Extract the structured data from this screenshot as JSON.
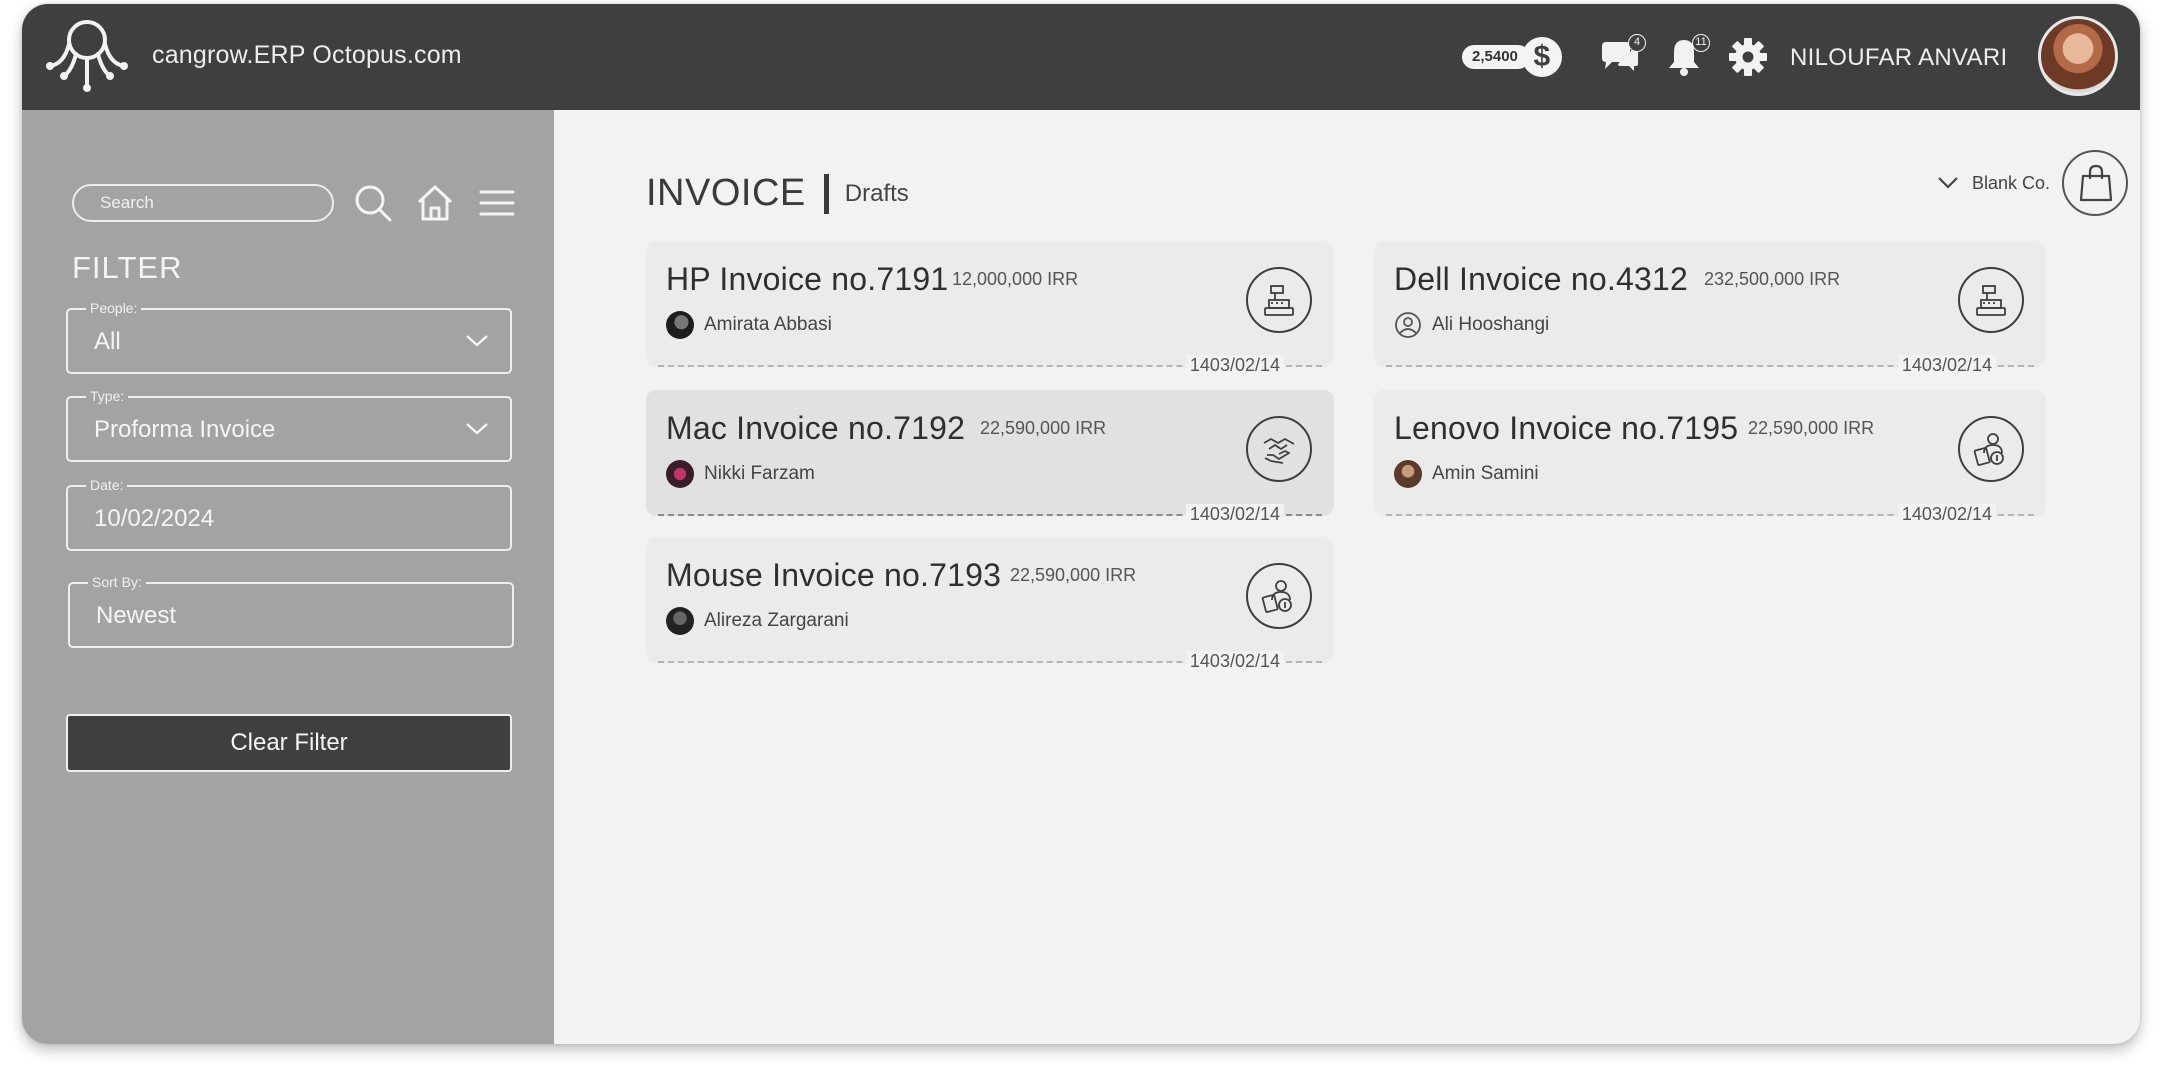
{
  "header": {
    "app_title": "cangrow.ERP Octopus.com",
    "balance": "2,5400",
    "currency_symbol": "$",
    "messages_count": "4",
    "notifications_count": "11",
    "user_name": "NILOUFAR ANVARI"
  },
  "sidebar": {
    "search_placeholder": "Search",
    "filter_title": "FILTER",
    "fields": [
      {
        "label": "People:",
        "value": "All"
      },
      {
        "label": "Type:",
        "value": "Proforma Invoice"
      },
      {
        "label": "Date:",
        "value": "10/02/2024"
      },
      {
        "label": "Sort By:",
        "value": "Newest"
      }
    ],
    "clear_button": "Clear Filter"
  },
  "main": {
    "title": "INVOICE",
    "subtitle": "Drafts",
    "company": "Blank Co.",
    "invoices": [
      {
        "title": "HP Invoice no.7191",
        "amount": "12,000,000 IRR",
        "person": "Amirata Abbasi",
        "date": "1403/02/14",
        "icon": "cash-register-icon"
      },
      {
        "title": "Mac Invoice no.7192",
        "amount": "22,590,000 IRR",
        "person": "Nikki Farzam",
        "date": "1403/02/14",
        "icon": "handshake-icon"
      },
      {
        "title": "Mouse Invoice no.7193",
        "amount": "22,590,000 IRR",
        "person": "Alireza Zargarani",
        "date": "1403/02/14",
        "icon": "client-money-icon"
      },
      {
        "title": "Dell Invoice no.4312",
        "amount": "232,500,000 IRR",
        "person": "Ali Hooshangi",
        "date": "1403/02/14",
        "icon": "cash-register-icon"
      },
      {
        "title": "Lenovo Invoice no.7195",
        "amount": "22,590,000 IRR",
        "person": "Amin Samini",
        "date": "1403/02/14",
        "icon": "client-money-icon"
      }
    ]
  },
  "colors": {
    "header_bg": "#3f3f3f",
    "sidebar_bg": "#a3a3a3",
    "main_bg": "#f2f2f2",
    "card_bg": "#ebebeb",
    "active_card_bg": "#e1e1e1"
  }
}
